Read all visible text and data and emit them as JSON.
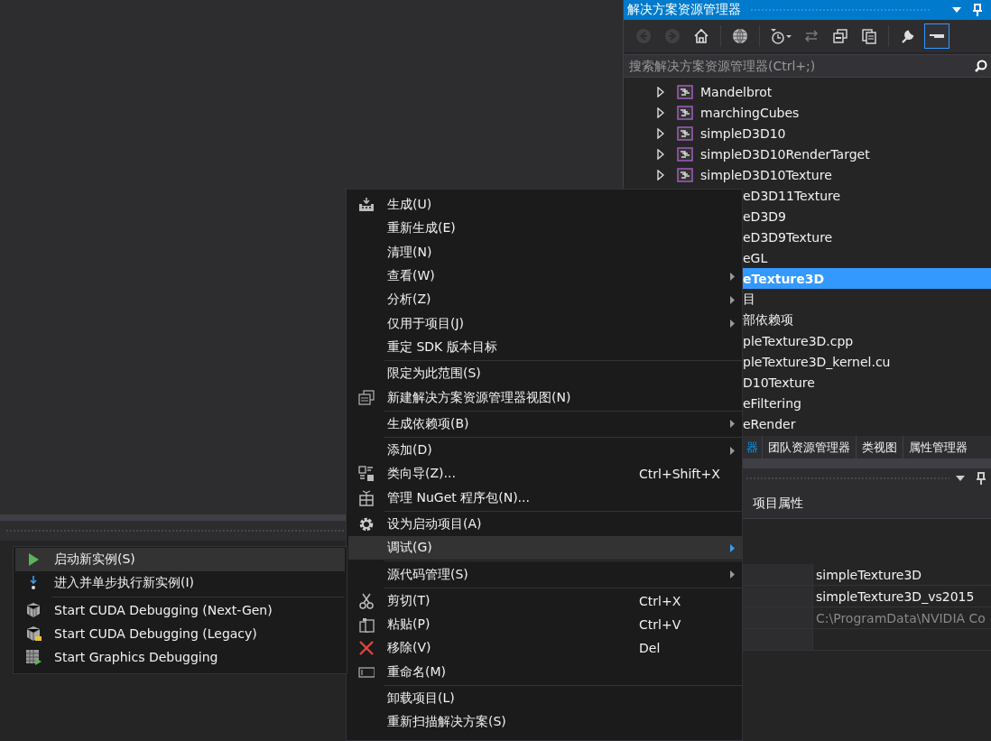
{
  "solution_explorer": {
    "title": "解决方案资源管理器",
    "toolbar": [
      {
        "kind": "back",
        "disabled": true,
        "checked": false
      },
      {
        "kind": "forward",
        "disabled": true,
        "checked": false
      },
      {
        "kind": "home",
        "disabled": false,
        "checked": false
      },
      {
        "kind": "globe",
        "disabled": false,
        "checked": false
      },
      {
        "kind": "history",
        "disabled": false,
        "checked": false
      },
      {
        "kind": "sync",
        "disabled": false,
        "checked": false
      },
      {
        "kind": "collapse",
        "disabled": false,
        "checked": false
      },
      {
        "kind": "pages",
        "disabled": false,
        "checked": false
      },
      {
        "kind": "wrench",
        "disabled": false,
        "checked": false
      },
      {
        "kind": "preview",
        "disabled": false,
        "checked": true
      }
    ],
    "search": {
      "placeholder": "搜索解决方案资源管理器(Ctrl+;)"
    },
    "tree": [
      {
        "kind": "project",
        "text": "Mandelbrot",
        "selected": false
      },
      {
        "kind": "project",
        "text": "marchingCubes",
        "selected": false
      },
      {
        "kind": "project",
        "text": "simpleD3D10",
        "selected": false
      },
      {
        "kind": "project",
        "text": "simpleD3D10RenderTarget",
        "selected": false
      },
      {
        "kind": "project",
        "text": "simpleD3D10Texture",
        "selected": false
      },
      {
        "kind": "partial",
        "text": "eD3D11Texture",
        "selected": false
      },
      {
        "kind": "partial",
        "text": "eD3D9",
        "selected": false
      },
      {
        "kind": "partial",
        "text": "eD3D9Texture",
        "selected": false
      },
      {
        "kind": "partial",
        "text": "eGL",
        "selected": false
      },
      {
        "kind": "partial",
        "text": "eTexture3D",
        "selected": true
      },
      {
        "kind": "partial",
        "text": "目",
        "selected": false
      },
      {
        "kind": "partial",
        "text": "部依赖项",
        "selected": false
      },
      {
        "kind": "partial",
        "text": "pleTexture3D.cpp",
        "selected": false
      },
      {
        "kind": "partial",
        "text": "pleTexture3D_kernel.cu",
        "selected": false
      },
      {
        "kind": "partial",
        "text": "D10Texture",
        "selected": false
      },
      {
        "kind": "partial",
        "text": "eFiltering",
        "selected": false
      },
      {
        "kind": "partial",
        "text": "eRender",
        "selected": false
      }
    ],
    "tabs": [
      {
        "label": "器",
        "selected": true
      },
      {
        "label": "团队资源管理器",
        "selected": false
      },
      {
        "label": "类视图",
        "selected": false
      },
      {
        "label": "属性管理器",
        "selected": false
      }
    ]
  },
  "properties": {
    "toolbar_label": "项目属性",
    "rows": [
      {
        "value": "simpleTexture3D",
        "dimmed": false
      },
      {
        "value": "simpleTexture3D_vs2015",
        "dimmed": false
      },
      {
        "value": "C:\\ProgramData\\NVIDIA Co",
        "dimmed": true
      }
    ]
  },
  "context_menu": {
    "items": [
      {
        "kind": "item",
        "label": "生成(U)",
        "submenu": false,
        "selected": false
      },
      {
        "kind": "item",
        "label": "重新生成(E)",
        "submenu": false,
        "selected": false
      },
      {
        "kind": "item",
        "label": "清理(N)",
        "submenu": false,
        "selected": false
      },
      {
        "kind": "item",
        "label": "查看(W)",
        "submenu": true,
        "selected": false
      },
      {
        "kind": "item",
        "label": "分析(Z)",
        "submenu": true,
        "selected": false
      },
      {
        "kind": "item",
        "label": "仅用于项目(J)",
        "submenu": true,
        "selected": false
      },
      {
        "kind": "item",
        "label": "重定 SDK 版本目标",
        "submenu": false,
        "selected": false
      },
      {
        "kind": "separator"
      },
      {
        "kind": "item",
        "label": "限定为此范围(S)",
        "submenu": false,
        "selected": false
      },
      {
        "kind": "item",
        "label": "新建解决方案资源管理器视图(N)",
        "submenu": false,
        "selected": false
      },
      {
        "kind": "separator"
      },
      {
        "kind": "item",
        "label": "生成依赖项(B)",
        "submenu": true,
        "selected": false
      },
      {
        "kind": "separator"
      },
      {
        "kind": "item",
        "label": "添加(D)",
        "submenu": true,
        "selected": false
      },
      {
        "kind": "item",
        "label": "类向导(Z)...",
        "shortcut": "Ctrl+Shift+X",
        "submenu": false,
        "selected": false
      },
      {
        "kind": "item",
        "label": "管理 NuGet 程序包(N)...",
        "submenu": false,
        "selected": false
      },
      {
        "kind": "separator"
      },
      {
        "kind": "item",
        "label": "设为启动项目(A)",
        "submenu": false,
        "selected": false
      },
      {
        "kind": "item",
        "label": "调试(G)",
        "submenu": true,
        "selected": true
      },
      {
        "kind": "separator"
      },
      {
        "kind": "item",
        "label": "源代码管理(S)",
        "submenu": true,
        "selected": false
      },
      {
        "kind": "separator"
      },
      {
        "kind": "item",
        "label": "剪切(T)",
        "shortcut": "Ctrl+X",
        "submenu": false,
        "selected": false
      },
      {
        "kind": "item",
        "label": "粘贴(P)",
        "shortcut": "Ctrl+V",
        "submenu": false,
        "selected": false
      },
      {
        "kind": "item",
        "label": "移除(V)",
        "shortcut": "Del",
        "submenu": false,
        "selected": false
      },
      {
        "kind": "item",
        "label": "重命名(M)",
        "submenu": false,
        "selected": false
      },
      {
        "kind": "separator"
      },
      {
        "kind": "item",
        "label": "卸载项目(L)",
        "submenu": false,
        "selected": false
      },
      {
        "kind": "item",
        "label": "重新扫描解决方案(S)",
        "submenu": false,
        "selected": false
      }
    ]
  },
  "debug_submenu": {
    "items": [
      {
        "kind": "item",
        "label": "启动新实例(S)",
        "selected": true
      },
      {
        "kind": "item",
        "label": "进入并单步执行新实例(I)",
        "selected": false
      },
      {
        "kind": "separator"
      },
      {
        "kind": "item",
        "label": "Start CUDA Debugging (Next-Gen)",
        "selected": false
      },
      {
        "kind": "item",
        "label": "Start CUDA Debugging (Legacy)",
        "selected": false
      },
      {
        "kind": "item",
        "label": "Start Graphics Debugging",
        "selected": false
      }
    ]
  }
}
